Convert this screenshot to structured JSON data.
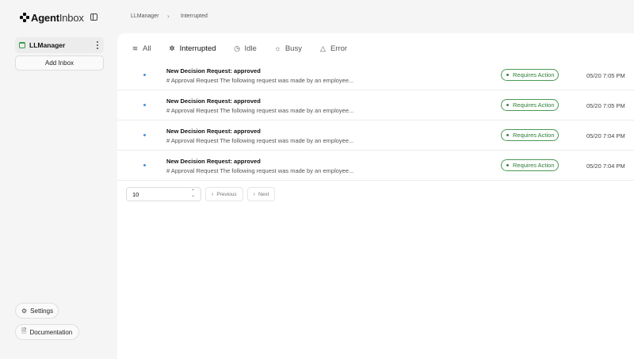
{
  "app": {
    "logo_bold": "Agent",
    "logo_light": "Inbox"
  },
  "sidebar": {
    "inbox_name": "LLManager",
    "add_inbox_label": "Add Inbox",
    "settings_label": "Settings",
    "documentation_label": "Documentation"
  },
  "breadcrumb": {
    "root": "LLManager",
    "current": "Interrupted"
  },
  "tabs": [
    {
      "label": "All",
      "icon": "layers-icon"
    },
    {
      "label": "Interrupted",
      "icon": "zap-off-icon"
    },
    {
      "label": "Idle",
      "icon": "clock-icon"
    },
    {
      "label": "Busy",
      "icon": "loader-icon"
    },
    {
      "label": "Error",
      "icon": "alert-triangle-icon"
    }
  ],
  "threads": [
    {
      "title": "New Decision Request: approved",
      "description": "# Approval Request The following request was made by an employee...",
      "status": "Requires Action",
      "time": "05/20 7:05 PM"
    },
    {
      "title": "New Decision Request: approved",
      "description": "# Approval Request The following request was made by an employee...",
      "status": "Requires Action",
      "time": "05/20 7:05 PM"
    },
    {
      "title": "New Decision Request: approved",
      "description": "# Approval Request The following request was made by an employee...",
      "status": "Requires Action",
      "time": "05/20 7:04 PM"
    },
    {
      "title": "New Decision Request: approved",
      "description": "# Approval Request The following request was made by an employee...",
      "status": "Requires Action",
      "time": "05/20 7:04 PM"
    }
  ],
  "pagination": {
    "page_size": "10",
    "previous_label": "Previous",
    "next_label": "Next"
  },
  "colors": {
    "status_green": "#4a9a52",
    "unread_dot": "#4a90d9",
    "sidebar_bg": "#f5f5f5"
  }
}
